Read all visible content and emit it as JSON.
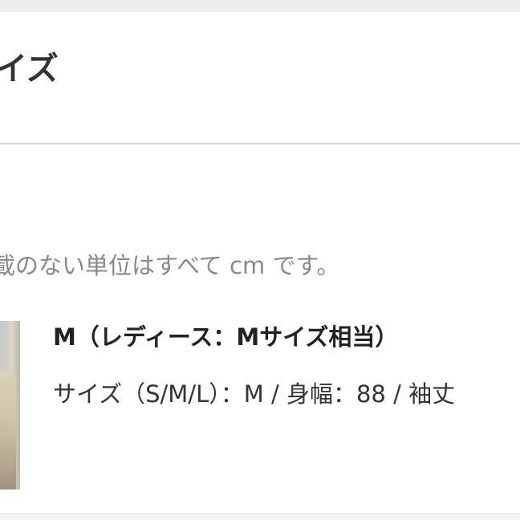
{
  "header": {
    "title": "イズ"
  },
  "note": {
    "units": "載のない単位はすべて cm です。"
  },
  "product": {
    "name": "M（レディース：Mサイズ相当）",
    "spec": "サイズ（S/M/L）：M / 身幅：88 / 袖丈"
  }
}
